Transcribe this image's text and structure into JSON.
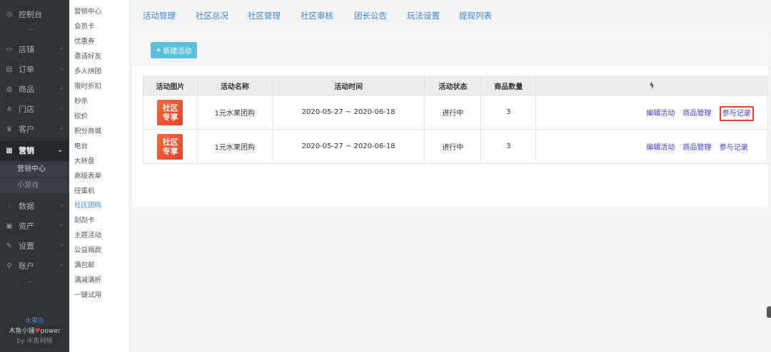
{
  "sidebar": {
    "top_item": {
      "label": "控制台",
      "icon": "dashboard-icon"
    },
    "items": [
      {
        "label": "店铺",
        "icon": "shop-icon"
      },
      {
        "label": "订单",
        "icon": "order-icon"
      },
      {
        "label": "商品",
        "icon": "goods-icon"
      },
      {
        "label": "门店",
        "icon": "store-icon"
      },
      {
        "label": "客户",
        "icon": "customer-icon"
      },
      {
        "label": "营销",
        "icon": "marketing-icon"
      },
      {
        "label": "数据",
        "icon": "data-icon"
      },
      {
        "label": "资产",
        "icon": "assets-icon"
      },
      {
        "label": "设置",
        "icon": "settings-icon"
      },
      {
        "label": "账户",
        "icon": "account-icon"
      }
    ],
    "marketing_sub": [
      "营销中心",
      "小游戏"
    ],
    "separator": "—",
    "footer": {
      "shop": "水果店",
      "brand": "木鱼小铺",
      "power": "power",
      "by": "by 木鱼网络"
    }
  },
  "submenu": {
    "items": [
      "营销中心",
      "会员卡",
      "优惠券",
      "邀请好友",
      "多人拼团",
      "限时折扣",
      "秒杀",
      "砍价",
      "积分商城",
      "电台",
      "大转盘",
      "高级表单",
      "扭蛋机",
      "社区团购",
      "刮刮卡",
      "主题活动",
      "公益捐款",
      "满包邮",
      "满减满折",
      "一键试用"
    ],
    "current": "社区团购"
  },
  "tabs": [
    "活动管理",
    "社区总况",
    "社区管理",
    "社区审核",
    "团长公告",
    "玩法设置",
    "提现列表"
  ],
  "toolbar": {
    "new_label": "新建活动"
  },
  "table": {
    "headers": [
      "活动图片",
      "活动名称",
      "活动时间",
      "活动状态",
      "商品数量",
      "ϟ"
    ],
    "rows": [
      {
        "thumb_line1": "社区",
        "thumb_line2": "专享",
        "name": "1元水果团购",
        "time": "2020-05-27 ~ 2020-06-18",
        "status": "进行中",
        "count": "3",
        "ops": [
          "编辑活动",
          "商品管理",
          "参与记录"
        ]
      },
      {
        "thumb_line1": "社区",
        "thumb_line2": "专享",
        "name": "1元水果团购",
        "time": "2020-05-27 ~ 2020-06-18",
        "status": "进行中",
        "count": "3",
        "ops": [
          "编辑活动",
          "商品管理",
          "参与记录"
        ]
      }
    ]
  },
  "colors": {
    "accent": "#3a86d9",
    "button": "#5bc0de",
    "sidebar": "#2f3237",
    "highlight": "#e0423a"
  }
}
